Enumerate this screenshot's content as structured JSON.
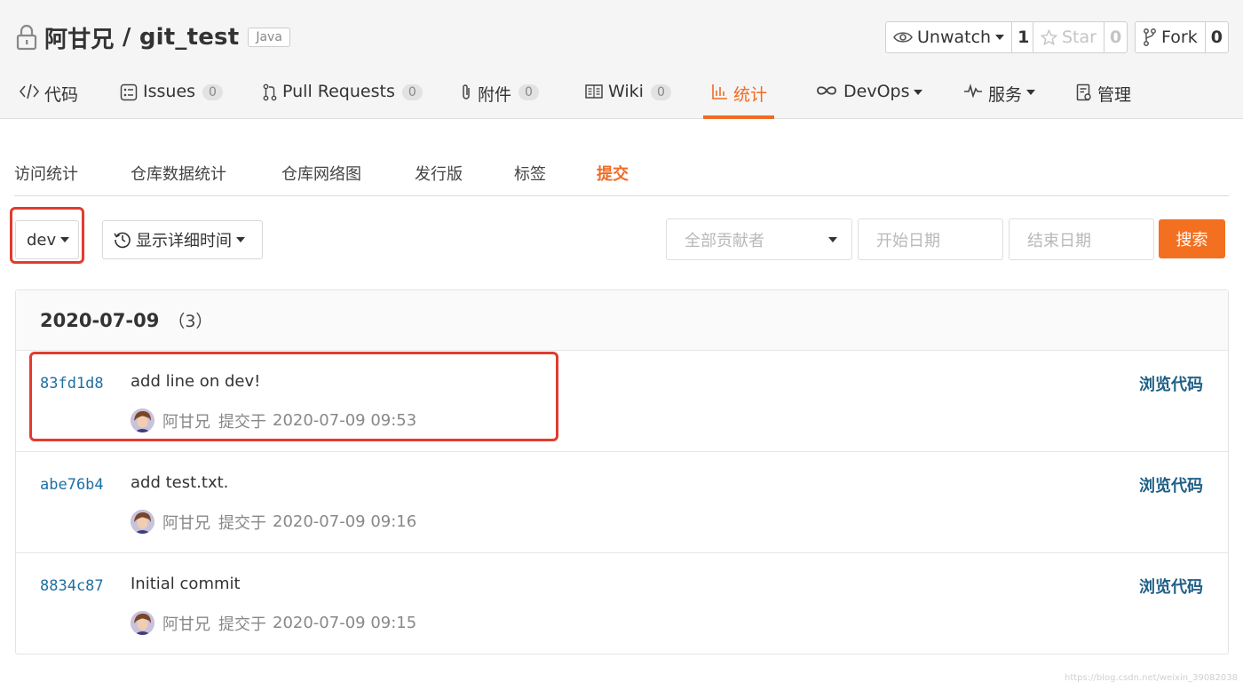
{
  "repo": {
    "owner": "阿甘兄",
    "separator": " / ",
    "name": "git_test",
    "language": "Java"
  },
  "actions": {
    "watch": {
      "label": "Unwatch",
      "count": "1"
    },
    "star": {
      "label": "Star",
      "count": "0"
    },
    "fork": {
      "label": "Fork",
      "count": "0"
    }
  },
  "nav": [
    {
      "label": "代码",
      "icon": "code-icon"
    },
    {
      "label": "Issues",
      "badge": "0",
      "icon": "issues-icon"
    },
    {
      "label": "Pull Requests",
      "badge": "0",
      "icon": "pull-request-icon"
    },
    {
      "label": "附件",
      "badge": "0",
      "icon": "attachment-icon"
    },
    {
      "label": "Wiki",
      "badge": "0",
      "icon": "wiki-icon"
    },
    {
      "label": "统计",
      "icon": "stats-icon",
      "active": true
    },
    {
      "label": "DevOps",
      "icon": "devops-icon"
    },
    {
      "label": "服务",
      "icon": "service-icon"
    },
    {
      "label": "管理",
      "icon": "manage-icon"
    }
  ],
  "subtabs": [
    "访问统计",
    "仓库数据统计",
    "仓库网络图",
    "发行版",
    "标签",
    "提交"
  ],
  "filters": {
    "branch": "dev",
    "time_toggle": "显示详细时间",
    "contributor_placeholder": "全部贡献者",
    "start_placeholder": "开始日期",
    "end_placeholder": "结束日期",
    "search": "搜索"
  },
  "commit_group": {
    "date": "2020-07-09",
    "count": "（3）",
    "commits": [
      {
        "sha": "83fd1d8",
        "message": "add line on dev!",
        "author": "阿甘兄",
        "action": "提交于",
        "time": "2020-07-09 09:53",
        "browse": "浏览代码"
      },
      {
        "sha": "abe76b4",
        "message": "add test.txt.",
        "author": "阿甘兄",
        "action": "提交于",
        "time": "2020-07-09 09:16",
        "browse": "浏览代码"
      },
      {
        "sha": "8834c87",
        "message": "Initial commit",
        "author": "阿甘兄",
        "action": "提交于",
        "time": "2020-07-09 09:15",
        "browse": "浏览代码"
      }
    ]
  },
  "watermark": "https://blog.csdn.net/weixin_39082038",
  "colors": {
    "accent": "#f16b24",
    "link": "#1e5f86",
    "sha": "#1f6fa3",
    "highlight": "#e23b2e"
  }
}
